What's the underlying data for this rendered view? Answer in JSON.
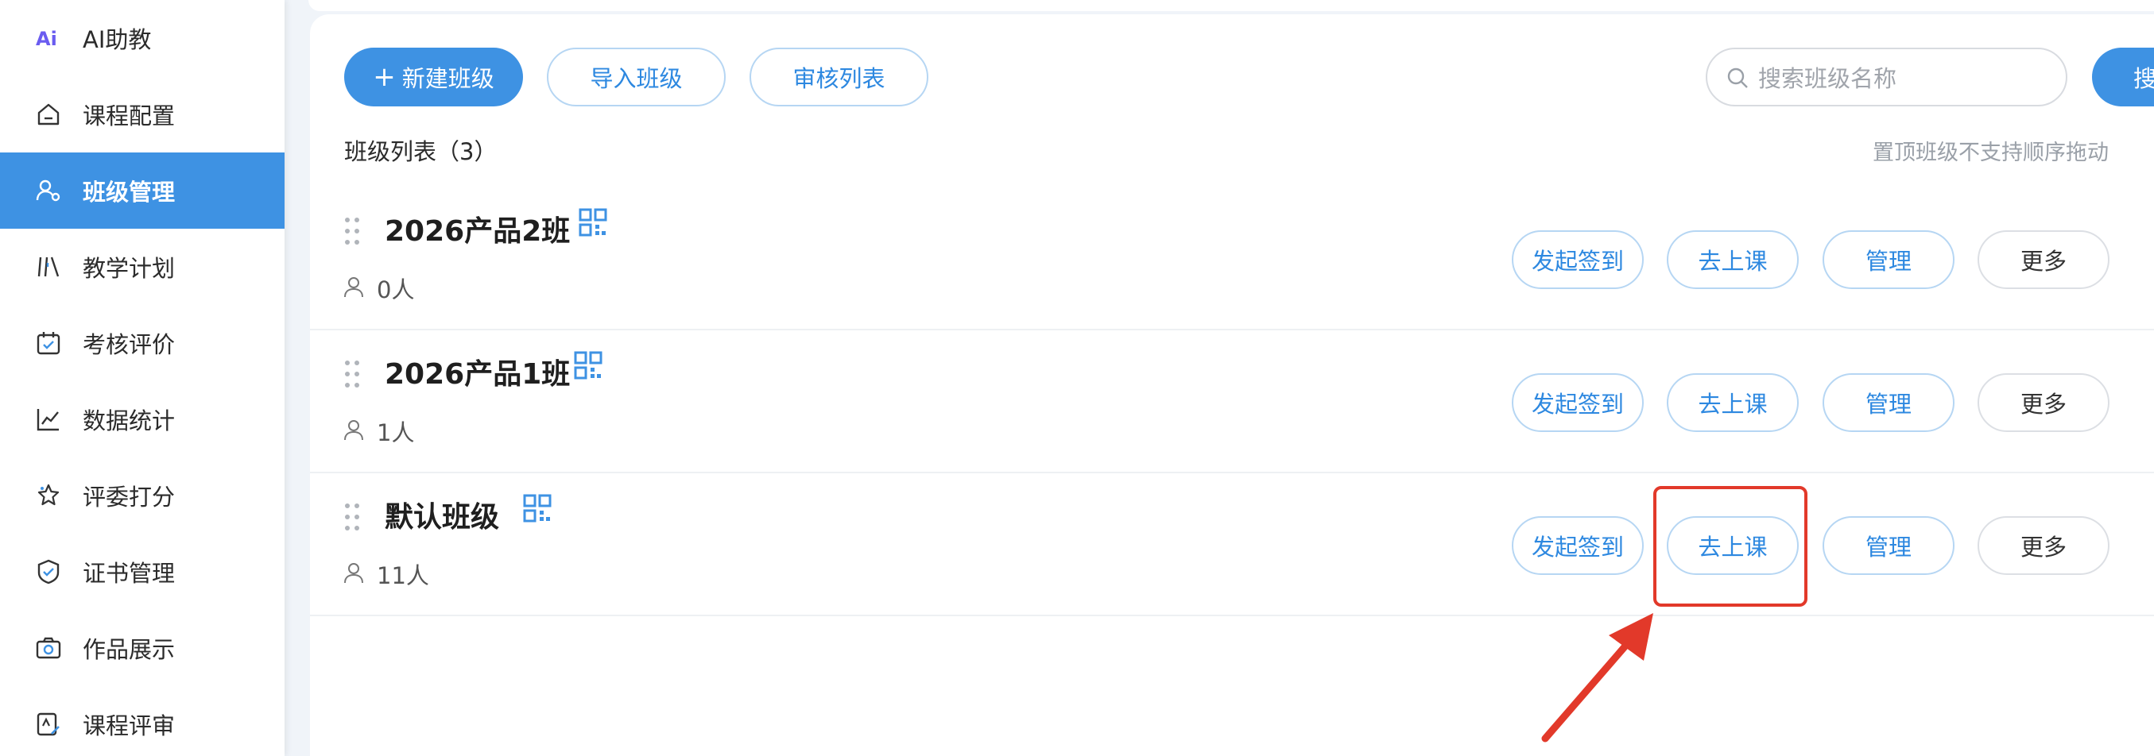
{
  "sidebar": {
    "items": [
      {
        "label": "AI助教",
        "icon": "ai-icon",
        "active": false
      },
      {
        "label": "课程配置",
        "icon": "home-icon",
        "active": false
      },
      {
        "label": "班级管理",
        "icon": "users-icon",
        "active": true
      },
      {
        "label": "教学计划",
        "icon": "books-icon",
        "active": false
      },
      {
        "label": "考核评价",
        "icon": "calendar-check-icon",
        "active": false
      },
      {
        "label": "数据统计",
        "icon": "line-chart-icon",
        "active": false
      },
      {
        "label": "评委打分",
        "icon": "star-icon",
        "active": false
      },
      {
        "label": "证书管理",
        "icon": "shield-icon",
        "active": false
      },
      {
        "label": "作品展示",
        "icon": "camera-icon",
        "active": false
      },
      {
        "label": "课程评审",
        "icon": "review-icon",
        "active": false
      }
    ]
  },
  "toolbar": {
    "new_class": "新建班级",
    "import_class": "导入班级",
    "review_list": "审核列表",
    "search_placeholder": "搜索班级名称",
    "search_button": "搜"
  },
  "list": {
    "title": "班级列表（3）",
    "hint": "置顶班级不支持顺序拖动"
  },
  "classes": [
    {
      "name": "2026产品2班",
      "count": "0人"
    },
    {
      "name": "2026产品1班",
      "count": "1人"
    },
    {
      "name": "默认班级",
      "count": "11人"
    }
  ],
  "row_actions": {
    "sign_in": "发起签到",
    "go_class": "去上课",
    "manage": "管理",
    "more": "更多"
  },
  "colors": {
    "primary": "#3e92e3",
    "outline_text": "#2d88e0",
    "annotation": "#e2392a"
  }
}
